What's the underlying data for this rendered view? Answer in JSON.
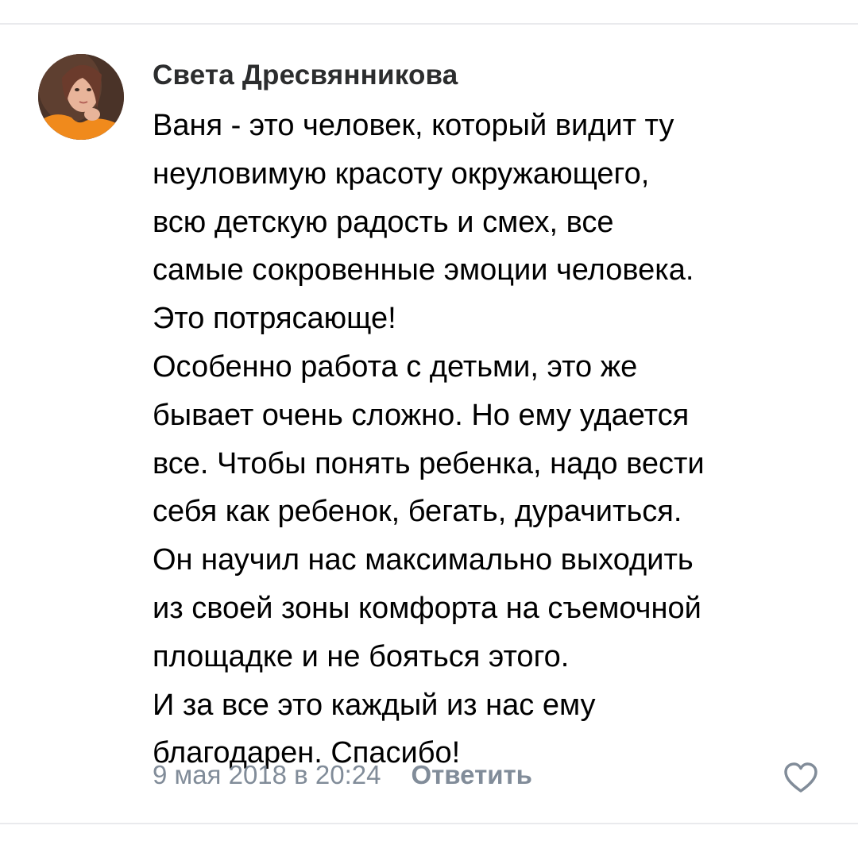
{
  "comment": {
    "author": "Света Дресвянникова",
    "avatar_icon": "user-photo-avatar",
    "text": "Ваня - это человек, который видит ту\nнеуловимую красоту окружающего,\nвсю детскую радость и смех, все\nсамые сокровенные эмоции человека.\nЭто потрясающе!\nОсобенно работа с детьми, это же\nбывает очень сложно. Но ему удается\nвсе. Чтобы понять ребенка, надо вести\nсебя как ребенок, бегать, дурачиться.\nОн научил нас максимально выходить\nиз своей зоны комфорта на съемочной\nплощадке и не бояться этого.\nИ за все это каждый из нас ему\nблагодарен. Спасибо!",
    "timestamp": "9 мая 2018 в 20:24",
    "reply_label": "Ответить",
    "like_icon": "heart-outline-icon"
  },
  "colors": {
    "text_primary": "#000000",
    "author": "#2c2d2e",
    "secondary": "#818c99",
    "divider": "#e9eaed",
    "background": "#ffffff"
  }
}
